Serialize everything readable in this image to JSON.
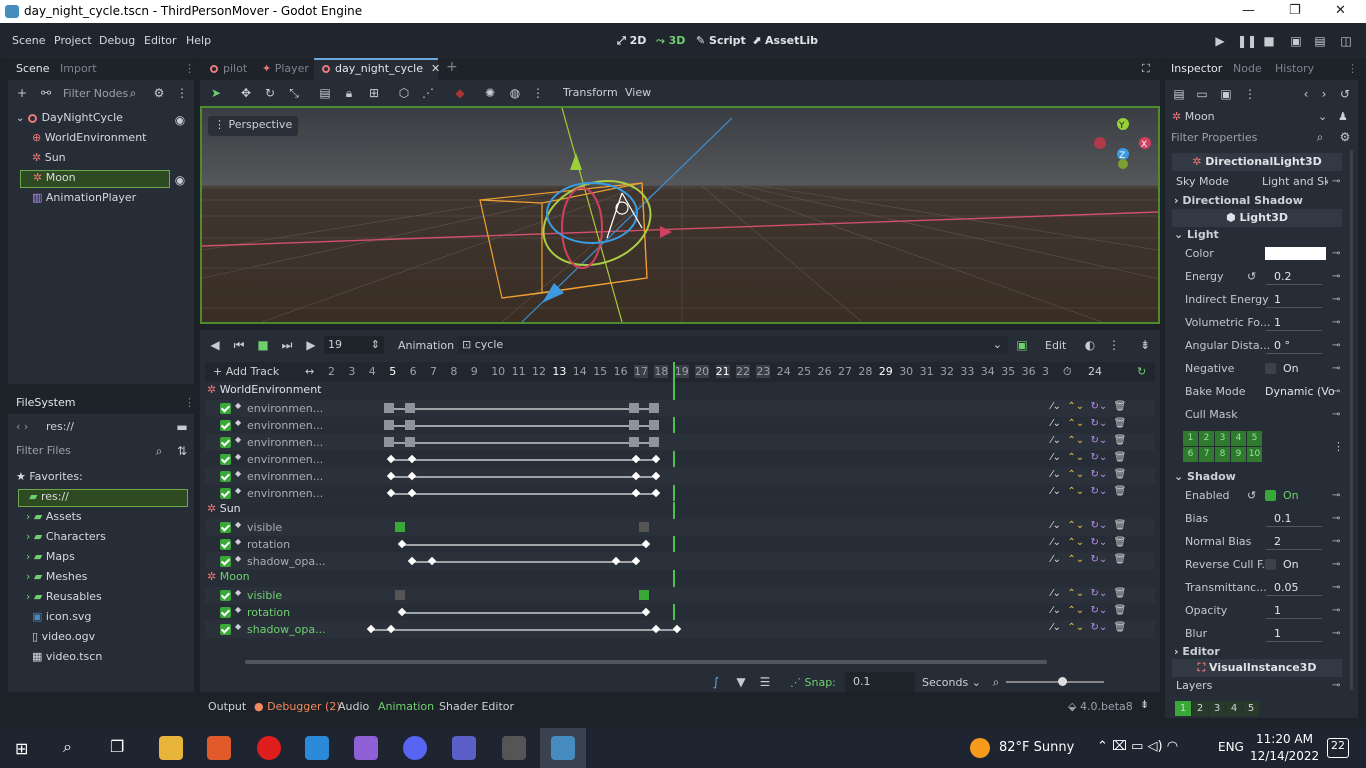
{
  "window": {
    "title": "day_night_cycle.tscn - ThirdPersonMover - Godot Engine"
  },
  "menu": [
    "Scene",
    "Project",
    "Debug",
    "Editor",
    "Help"
  ],
  "modes": [
    "2D",
    "3D",
    "Script",
    "AssetLib"
  ],
  "scene_dock": {
    "tabs": [
      "Scene",
      "Import"
    ],
    "filter": "Filter Nodes",
    "nodes": [
      "DayNightCycle",
      "WorldEnvironment",
      "Sun",
      "Moon",
      "AnimationPlayer"
    ]
  },
  "filesystem": {
    "tab": "FileSystem",
    "path": "res://",
    "filter": "Filter Files",
    "favorites": "Favorites:",
    "items": [
      "res://",
      "Assets",
      "Characters",
      "Maps",
      "Meshes",
      "Reusables",
      "icon.svg",
      "video.ogv",
      "video.tscn"
    ]
  },
  "editor_tabs": [
    "pilot",
    "Player",
    "day_night_cycle"
  ],
  "viewport": {
    "menu": [
      "Transform",
      "View"
    ],
    "perspective": "Perspective"
  },
  "anim": {
    "frame": "19",
    "animation_label": "Animation",
    "animation_name": "cycle",
    "edit": "Edit",
    "add_track": "Add Track",
    "ticks": [
      "2",
      "3",
      "4",
      "5",
      "6",
      "7",
      "8",
      "9",
      "10",
      "11",
      "12",
      "13",
      "14",
      "15",
      "16",
      "17",
      "18",
      "19",
      "20",
      "21",
      "22",
      "23",
      "24",
      "25",
      "26",
      "27",
      "28",
      "29",
      "30",
      "31",
      "32",
      "33",
      "34",
      "35",
      "36",
      "3"
    ],
    "length": "24",
    "snap_label": "Snap:",
    "snap": "0.1",
    "unit": "Seconds",
    "groups": [
      {
        "name": "WorldEnvironment",
        "tracks": [
          "environmen...",
          "environmen...",
          "environmen...",
          "environmen...",
          "environmen...",
          "environmen..."
        ]
      },
      {
        "name": "Sun",
        "tracks": [
          "visible",
          "rotation",
          "shadow_opa..."
        ]
      },
      {
        "name": "Moon",
        "tracks": [
          "visible",
          "rotation",
          "shadow_opa..."
        ]
      }
    ]
  },
  "bottom_tabs": [
    "Output",
    "Debugger (2)",
    "Audio",
    "Animation",
    "Shader Editor"
  ],
  "version": "4.0.beta8",
  "inspector": {
    "tabs": [
      "Inspector",
      "Node",
      "History"
    ],
    "node": "Moon",
    "filter": "Filter Properties",
    "class1": "DirectionalLight3D",
    "sky_mode_label": "Sky Mode",
    "sky_mode": "Light and Sky",
    "dir_shadow": "Directional Shadow",
    "class2": "Light3D",
    "light": "Light",
    "props": [
      {
        "k": "Color",
        "v": ""
      },
      {
        "k": "Energy",
        "v": "0.2"
      },
      {
        "k": "Indirect Energy",
        "v": "1"
      },
      {
        "k": "Volumetric Fo...",
        "v": "1"
      },
      {
        "k": "Angular Dista...",
        "v": "0 °"
      },
      {
        "k": "Negative",
        "v": "On"
      },
      {
        "k": "Bake Mode",
        "v": "Dynamic (Vo"
      },
      {
        "k": "Cull Mask",
        "v": ""
      }
    ],
    "mask": [
      "1",
      "2",
      "3",
      "4",
      "5",
      "6",
      "7",
      "8",
      "9",
      "10"
    ],
    "shadow": "Shadow",
    "shadow_props": [
      {
        "k": "Enabled",
        "v": "On"
      },
      {
        "k": "Bias",
        "v": "0.1"
      },
      {
        "k": "Normal Bias",
        "v": "2"
      },
      {
        "k": "Reverse Cull F...",
        "v": "On"
      },
      {
        "k": "Transmittanc...",
        "v": "0.05"
      },
      {
        "k": "Opacity",
        "v": "1"
      },
      {
        "k": "Blur",
        "v": "1"
      }
    ],
    "editor": "Editor",
    "class3": "VisualInstance3D",
    "layers": "Layers",
    "layer_nums": [
      "1",
      "2",
      "3",
      "4",
      "5"
    ]
  },
  "taskbar": {
    "weather": "82°F  Sunny",
    "lang": "ENG",
    "time": "11:20 AM",
    "date": "12/14/2022",
    "notif": "22"
  },
  "colors": {
    "accent": "#478cbf",
    "green": "#39a839",
    "panel": "#272d36"
  }
}
